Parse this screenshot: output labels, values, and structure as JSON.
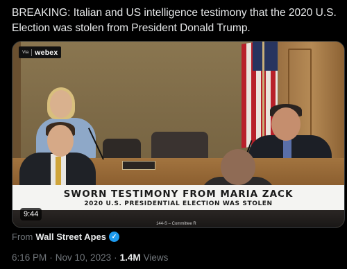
{
  "tweet": {
    "text": "BREAKING: Italian and US intelligence testimony that the 2020 U.S. Election was stolen from President Donald Trump."
  },
  "video": {
    "logo": {
      "via": "Via",
      "name": "webex"
    },
    "banner": {
      "title": "SWORN TESTIMONY FROM MARIA ZACK",
      "subtitle": "2020 U.S. PRESIDENTIAL ELECTION WAS STOLEN"
    },
    "bottom_caption": "144-S – Committee R",
    "timestamp": "9:44"
  },
  "attribution": {
    "prefix": "From",
    "user": "Wall Street Apes",
    "verified_icon": "verified-badge-icon"
  },
  "meta": {
    "time": "6:16 PM",
    "separator": "·",
    "date": "Nov 10, 2023",
    "views_count": "1.4M",
    "views_label": "Views"
  },
  "colors": {
    "background": "#000000",
    "text_primary": "#e7e9ea",
    "text_secondary": "#71767b",
    "verified": "#1d9bf0",
    "banner_bg": "#f4f4f2"
  }
}
